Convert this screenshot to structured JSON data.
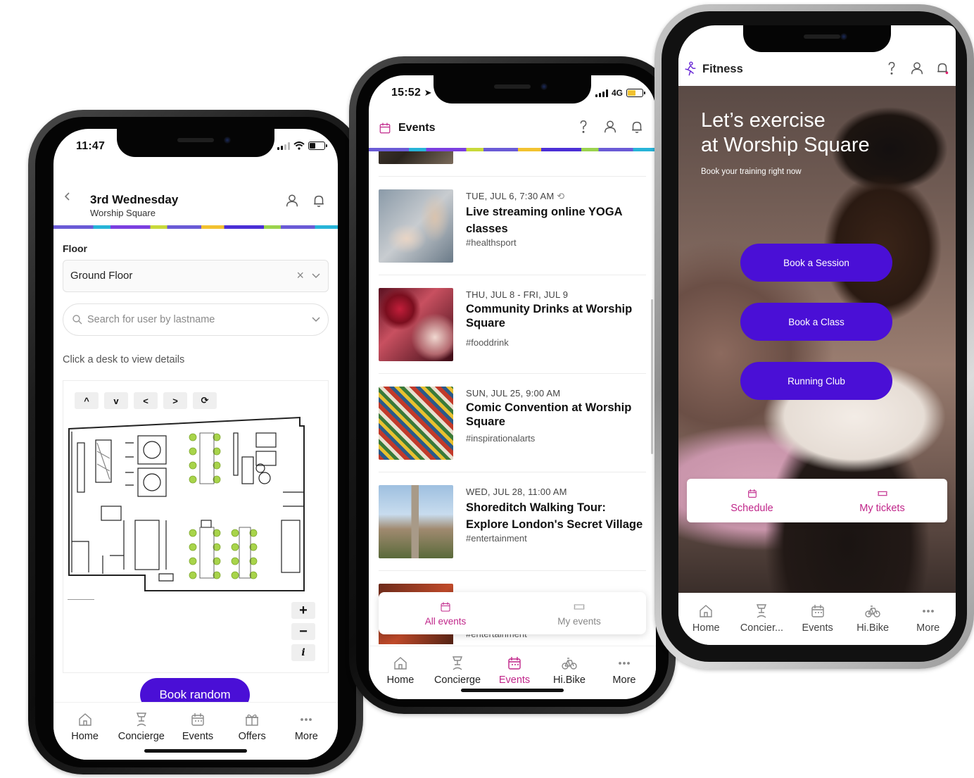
{
  "colors": {
    "accent_purple": "#4a0fd6",
    "active_pink": "#c0268a",
    "desk_green": "#a8d44a"
  },
  "phone1": {
    "status_time": "11:47",
    "header": {
      "title": "3rd Wednesday",
      "subtitle": "Worship Square"
    },
    "floor_label": "Floor",
    "floor_value": "Ground Floor",
    "search_placeholder": "Search for user by lastname",
    "hint": "Click a desk to view details",
    "map_controls": [
      "^",
      "v",
      "<",
      ">",
      "⟳"
    ],
    "zoom_controls": [
      "+",
      "−",
      "i"
    ],
    "book_button": "Book random",
    "tabs": [
      {
        "label": "Home",
        "icon": "home-icon"
      },
      {
        "label": "Concierge",
        "icon": "concierge-icon"
      },
      {
        "label": "Events",
        "icon": "calendar-icon"
      },
      {
        "label": "Offers",
        "icon": "gift-icon"
      },
      {
        "label": "More",
        "icon": "more-icon"
      }
    ]
  },
  "phone2": {
    "status_time": "15:52",
    "network": "4G",
    "header_title": "Events",
    "events": [
      {
        "date": "TUE, JUL 6, 7:30 AM",
        "title": "Live streaming online YOGA classes",
        "tag": "#healthsport",
        "recurring": true
      },
      {
        "date": "THU, JUL 8 - FRI, JUL 9",
        "title": "Community Drinks at Worship Square",
        "tag": "#fooddrink"
      },
      {
        "date": "SUN, JUL 25, 9:00 AM",
        "title": "Comic Convention at Worship Square",
        "tag": "#inspirationalarts"
      },
      {
        "date": "WED, JUL 28, 11:00 AM",
        "title": "Shoreditch Walking Tour: Explore London's Secret Village",
        "tag": "#entertainment"
      },
      {
        "date": "",
        "title": "",
        "tag": "#entertainment"
      }
    ],
    "segment_tabs": [
      "All events",
      "My events"
    ],
    "tabs": [
      {
        "label": "Home",
        "icon": "home-icon"
      },
      {
        "label": "Concierge",
        "icon": "concierge-icon"
      },
      {
        "label": "Events",
        "icon": "calendar-icon",
        "active": true
      },
      {
        "label": "Hi.Bike",
        "icon": "bike-icon"
      },
      {
        "label": "More",
        "icon": "more-icon"
      }
    ]
  },
  "phone3": {
    "header_title": "Fitness",
    "hero_title_line1": "Let’s exercise",
    "hero_title_line2": "at Worship Square",
    "hero_subtitle": "Book your training right now",
    "buttons": [
      "Book a Session",
      "Book a Class",
      "Running Club"
    ],
    "segment_tabs": [
      "Schedule",
      "My tickets"
    ],
    "tabs": [
      {
        "label": "Home",
        "icon": "home-icon"
      },
      {
        "label": "Concier...",
        "icon": "concierge-icon"
      },
      {
        "label": "Events",
        "icon": "calendar-icon"
      },
      {
        "label": "Hi.Bike",
        "icon": "bike-icon"
      },
      {
        "label": "More",
        "icon": "more-icon"
      }
    ]
  }
}
